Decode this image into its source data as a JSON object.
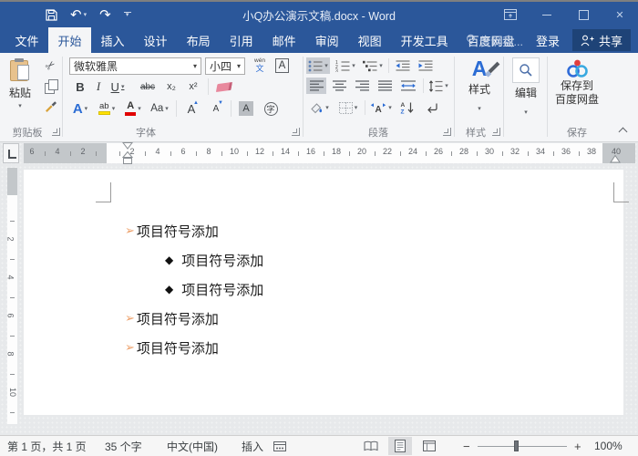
{
  "colors": {
    "titlebar_blue": "#2b579a",
    "active_tab_blue": "#2b579a",
    "share_box_blue": "#1e4377",
    "bullet_arrow_orange": "#eda06a",
    "highlight_yellow": "#ffe100",
    "font_color_red": "#e00000",
    "clipboard_tan": "#e8c28d"
  },
  "titlebar": {
    "title": "小Q办公演示文稿.docx - Word"
  },
  "tabs": {
    "items": [
      {
        "id": "file",
        "label": "文件",
        "active": false
      },
      {
        "id": "home",
        "label": "开始",
        "active": true
      },
      {
        "id": "insert",
        "label": "插入",
        "active": false
      },
      {
        "id": "design",
        "label": "设计",
        "active": false
      },
      {
        "id": "layout",
        "label": "布局",
        "active": false
      },
      {
        "id": "references",
        "label": "引用",
        "active": false
      },
      {
        "id": "mailings",
        "label": "邮件",
        "active": false
      },
      {
        "id": "review",
        "label": "审阅",
        "active": false
      },
      {
        "id": "view",
        "label": "视图",
        "active": false
      },
      {
        "id": "developer",
        "label": "开发工具",
        "active": false
      },
      {
        "id": "baidu-netdisk",
        "label": "百度网盘",
        "active": false
      }
    ],
    "tell_me": "告诉我...",
    "sign_in": "登录",
    "share": "共享"
  },
  "ribbon": {
    "clipboard": {
      "paste_label": "粘贴",
      "group_label": "剪贴板"
    },
    "font": {
      "font_name": "微软雅黑",
      "font_size": "小四",
      "phonetic_top": "wén",
      "phonetic_bottom": "文",
      "char_border": "A",
      "bold": "B",
      "italic": "I",
      "underline": "U",
      "strikethrough": "abc",
      "subscript": "x₂",
      "superscript": "x²",
      "text_effects": "A",
      "highlight": "ab",
      "font_color": "A",
      "change_case": "Aa",
      "grow_font": "A",
      "shrink_font": "A",
      "char_shading": "A",
      "enclose": "字",
      "group_label": "字体"
    },
    "paragraph": {
      "group_label": "段落",
      "sort_a": "A",
      "sort_z": "Z",
      "scale_letter": "A"
    },
    "styles": {
      "big_letter": "A",
      "button_label": "样式",
      "group_label": "样式"
    },
    "editing": {
      "button_label": "编辑"
    },
    "save": {
      "line1": "保存到",
      "line2": "百度网盘",
      "group_label": "保存"
    }
  },
  "ruler": {
    "h_left_numbers": [
      "6",
      "4",
      "2"
    ],
    "h_numbers": [
      "2",
      "4",
      "6",
      "8",
      "10",
      "12",
      "14",
      "16",
      "18",
      "20",
      "22",
      "24",
      "26",
      "28",
      "30",
      "32",
      "34",
      "36",
      "38"
    ],
    "h_right_numbers": [
      "40"
    ],
    "v_numbers": [
      "2",
      "4",
      "6",
      "8",
      "10"
    ]
  },
  "document": {
    "bullet_glyphs": {
      "arrow": "➢",
      "diamond": "◆"
    },
    "items": [
      {
        "level": 1,
        "bullet": "arrow",
        "text": "项目符号添加"
      },
      {
        "level": 2,
        "bullet": "diamond",
        "text": "项目符号添加"
      },
      {
        "level": 2,
        "bullet": "diamond",
        "text": "项目符号添加"
      },
      {
        "level": 1,
        "bullet": "arrow",
        "text": "项目符号添加"
      },
      {
        "level": 1,
        "bullet": "arrow",
        "text": "项目符号添加"
      }
    ]
  },
  "statusbar": {
    "page_info": "第 1 页，共 1 页",
    "word_count": "35 个字",
    "language": "中文(中国)",
    "insert_mode": "插入",
    "zoom_level": "100%"
  }
}
